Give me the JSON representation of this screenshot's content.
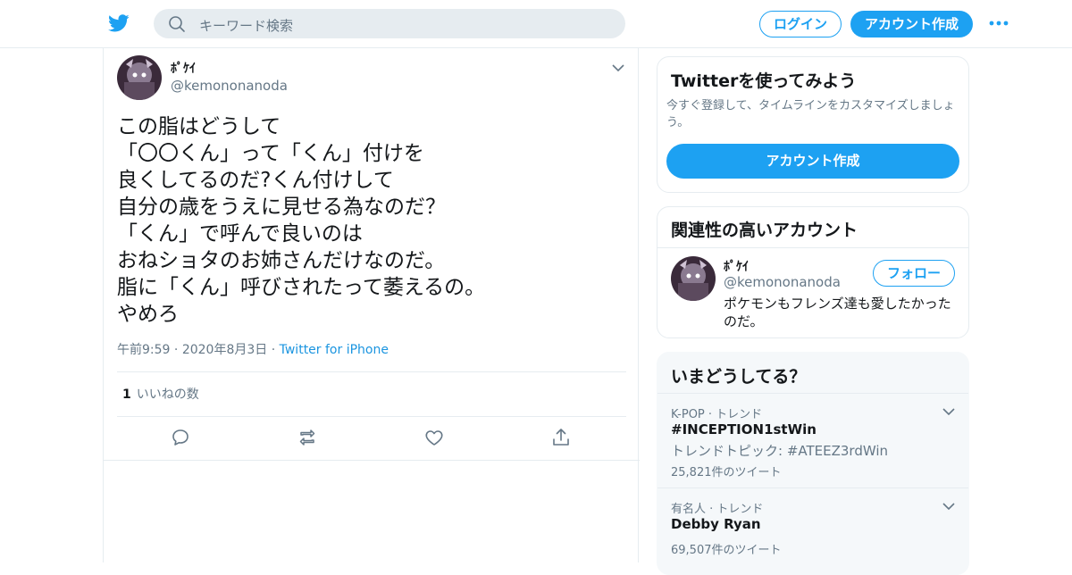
{
  "header": {
    "search_placeholder": "キーワード検索",
    "login_label": "ログイン",
    "signup_label": "アカウント作成"
  },
  "tweet": {
    "display_name": "ﾎﾟｹｲ",
    "handle": "@kemononanoda",
    "text": "この脂はどうして\n「〇〇くん」って「くん」付けを\n良くしてるのだ?くん付けして\n自分の歳をうえに見せる為なのだ？\n「くん」で呼んで良いのは\nおねショタのお姉さんだけなのだ。\n脂に「くん」呼びされたって萎えるの。\nやめろ",
    "time": "午前9:59",
    "date": "2020年8月3日",
    "source": "Twitter for iPhone",
    "like_count": "1",
    "like_label": "いいねの数"
  },
  "sidebar": {
    "signup_card": {
      "title": "Twitterを使ってみよう",
      "desc": "今すぐ登録して、タイムラインをカスタマイズしましょう。",
      "button": "アカウント作成"
    },
    "related": {
      "title": "関連性の高いアカウント",
      "name": "ﾎﾟｹｲ",
      "handle": "@kemononanoda",
      "follow_label": "フォロー",
      "bio": "ポケモンもフレンズ達も愛したかったのだ。"
    },
    "trends": {
      "title": "いまどうしてる？",
      "items": [
        {
          "category": "K-POP · トレンド",
          "name": "#INCEPTION1stWin",
          "sub": "トレンドトピック: #ATEEZ3rdWin",
          "count": "25,821件のツイート"
        },
        {
          "category": "有名人 · トレンド",
          "name": "Debby Ryan",
          "sub": "",
          "count": "69,507件のツイート"
        }
      ]
    }
  },
  "colors": {
    "brand": "#1da1f2",
    "muted": "#657786",
    "border": "#e6ecf0"
  }
}
